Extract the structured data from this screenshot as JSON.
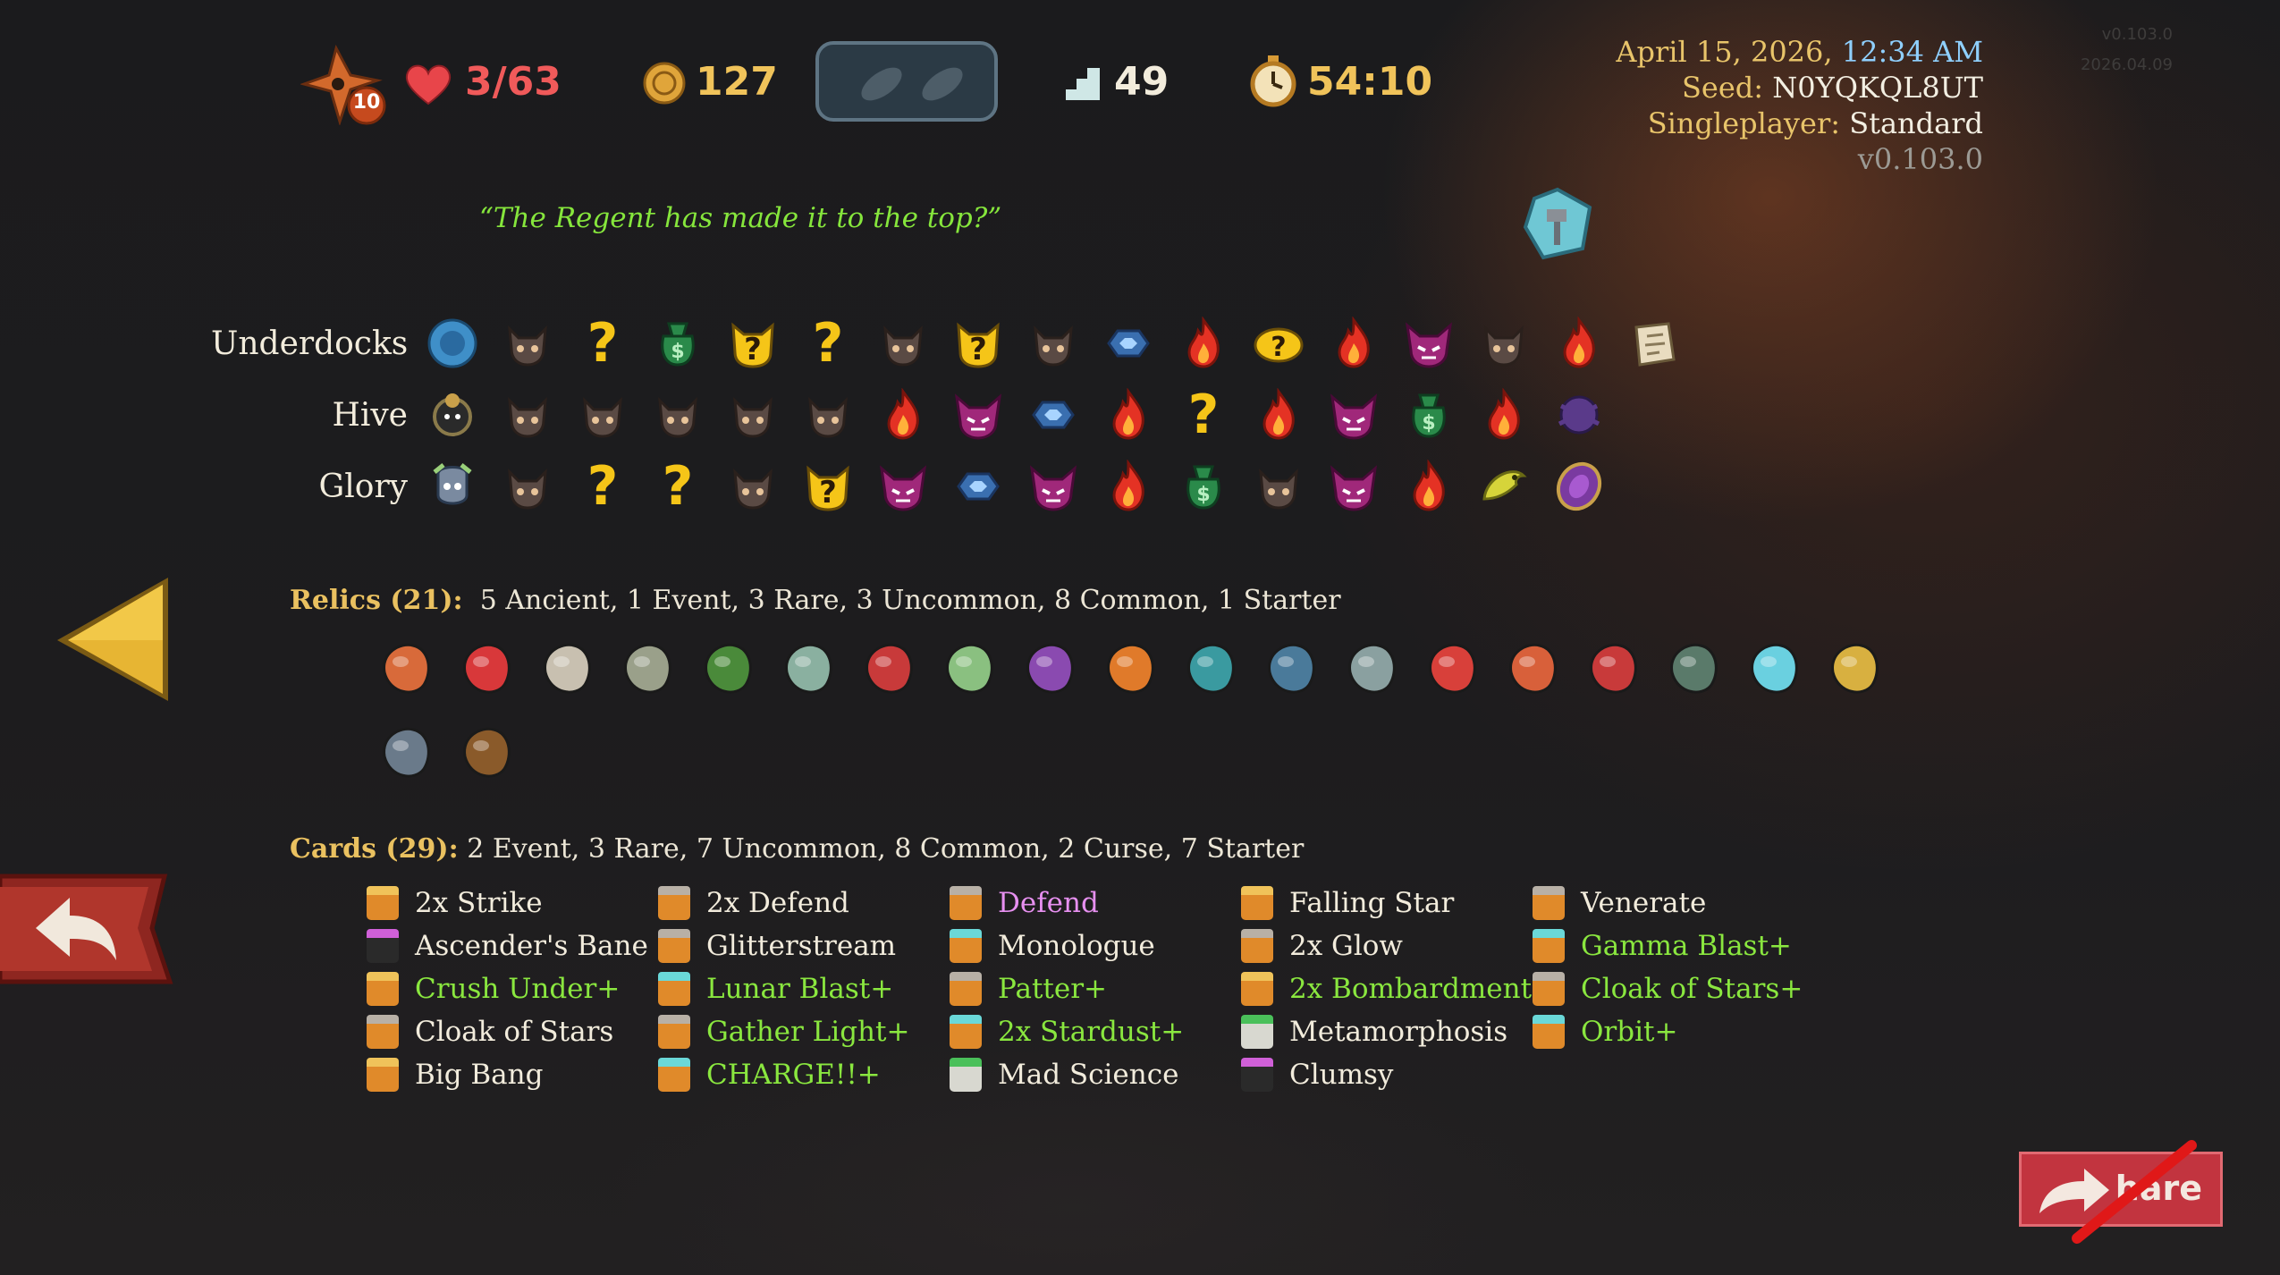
{
  "topbar": {
    "ascension": "10",
    "hp": "3/63",
    "gold": "127",
    "floor": "49",
    "time": "54:10"
  },
  "info": {
    "date": "April 15, 2026, ",
    "time": "12:34 AM",
    "seed_label": "Seed: ",
    "seed": "N0YQKQL8UT",
    "mode_label": "Singleplayer: ",
    "mode": "Standard",
    "version": "v0.103.0"
  },
  "corner_version": [
    "v0.103.0",
    "2026.04.09"
  ],
  "quote": "“The Regent has made it to the top?”",
  "acts": [
    {
      "name": "Underdocks",
      "nodes": [
        "boss-orb",
        "monster",
        "unknown",
        "treasure",
        "elite-unknown",
        "unknown",
        "monster",
        "elite-unknown",
        "monster",
        "shop",
        "rest",
        "event-gold",
        "rest",
        "elite",
        "monster",
        "rest",
        "map-scroll"
      ]
    },
    {
      "name": "Hive",
      "nodes": [
        "boss-hive",
        "monster",
        "monster",
        "monster",
        "monster",
        "monster",
        "rest",
        "elite",
        "shop",
        "rest",
        "unknown",
        "rest",
        "elite",
        "treasure",
        "rest",
        "boss-purple"
      ]
    },
    {
      "name": "Glory",
      "nodes": [
        "boss-glory",
        "monster",
        "unknown",
        "unknown",
        "monster",
        "elite-unknown",
        "elite",
        "shop",
        "elite",
        "rest",
        "treasure",
        "monster",
        "elite",
        "rest",
        "serpent",
        "gem"
      ]
    }
  ],
  "relics": {
    "heading": "Relics (21):",
    "summary": "5 Ancient,  1 Event,  3 Rare,  3 Uncommon,  8 Common,  1 Starter",
    "icons": [
      "ember-rock-icon",
      "dice-icon",
      "orb-icon",
      "candelabra-icon",
      "herb-icon",
      "dreamcatcher-icon",
      "red-horn-icon",
      "serpent-ring-icon",
      "purple-pillow-icon",
      "shuriken-icon",
      "bowl-icon",
      "anvil-icon",
      "newtons-cradle-icon",
      "lipstick-icon",
      "robe-icon",
      "red-cushion-icon",
      "teapot-icon",
      "prism-icon",
      "sunflower-icon",
      "helmet-icon",
      "stump-icon"
    ]
  },
  "cards": {
    "heading": "Cards (29):",
    "summary": "2 Event,  3 Rare,  7 Uncommon,  8 Common,  2 Curse,  7 Starter",
    "columns": [
      [
        {
          "name": "2x Strike",
          "style": "white",
          "icon": "gold"
        },
        {
          "name": "Ascender's Bane",
          "style": "white",
          "icon": "curse"
        },
        {
          "name": "Crush Under+",
          "style": "green",
          "icon": "gold"
        },
        {
          "name": "Cloak of Stars",
          "style": "white",
          "icon": "grey"
        },
        {
          "name": "Big Bang",
          "style": "white",
          "icon": "gold"
        }
      ],
      [
        {
          "name": "2x Defend",
          "style": "white",
          "icon": "grey"
        },
        {
          "name": "Glitterstream",
          "style": "white",
          "icon": "grey"
        },
        {
          "name": "Lunar Blast+",
          "style": "green",
          "icon": "teal"
        },
        {
          "name": "Gather Light+",
          "style": "green",
          "icon": "grey"
        },
        {
          "name": "CHARGE!!+",
          "style": "green",
          "icon": "teal"
        }
      ],
      [
        {
          "name": "Defend",
          "style": "pink",
          "icon": "grey"
        },
        {
          "name": "Monologue",
          "style": "white",
          "icon": "teal"
        },
        {
          "name": "Patter+",
          "style": "green",
          "icon": "grey"
        },
        {
          "name": "2x Stardust+",
          "style": "green",
          "icon": "teal"
        },
        {
          "name": "Mad Science",
          "style": "white",
          "icon": "green"
        }
      ],
      [
        {
          "name": "Falling Star",
          "style": "white",
          "icon": "gold"
        },
        {
          "name": "2x Glow",
          "style": "white",
          "icon": "grey"
        },
        {
          "name": "2x Bombardment+",
          "style": "green",
          "icon": "gold"
        },
        {
          "name": "Metamorphosis",
          "style": "white",
          "icon": "green"
        },
        {
          "name": "Clumsy",
          "style": "white",
          "icon": "curse"
        }
      ],
      [
        {
          "name": "Venerate",
          "style": "white",
          "icon": "grey"
        },
        {
          "name": "Gamma Blast+",
          "style": "green",
          "icon": "teal"
        },
        {
          "name": "Cloak of Stars+",
          "style": "green",
          "icon": "grey"
        },
        {
          "name": "Orbit+",
          "style": "green",
          "icon": "teal"
        }
      ]
    ]
  },
  "share_label": "hare",
  "colors": {
    "hp": "#f05a5a",
    "gold": "#f0c35a",
    "upgraded": "#8ae73f",
    "heading": "#eac160",
    "share": "#c2343f"
  }
}
